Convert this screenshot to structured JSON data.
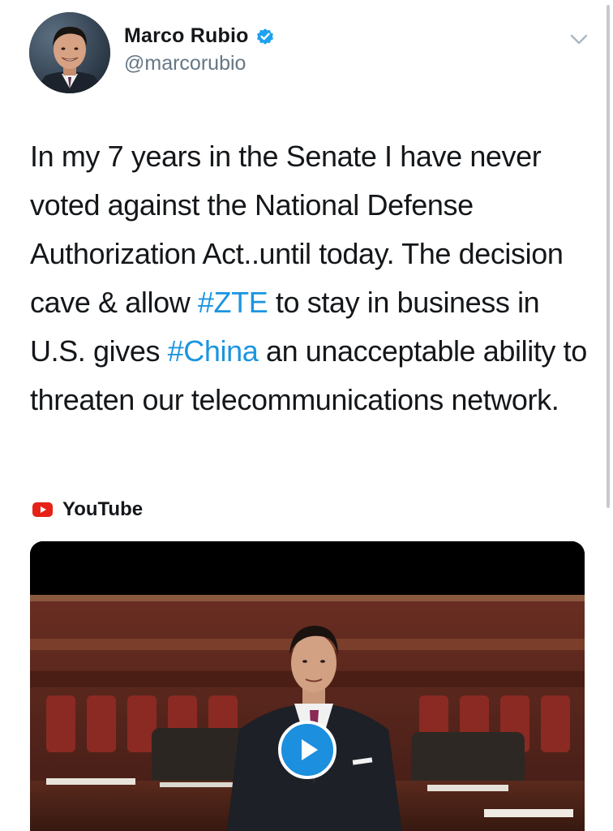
{
  "profile": {
    "display_name": "Marco Rubio",
    "handle": "@marcorubio",
    "verified": true,
    "avatar_icon": "profile-photo"
  },
  "menu": {
    "icon": "chevron-down-icon"
  },
  "tweet": {
    "segments": [
      {
        "text": "In my 7 years in the Senate I have never voted against the National Defense Authorization Act..until today. The decision cave & allow ",
        "type": "text"
      },
      {
        "text": "#ZTE",
        "type": "hashtag"
      },
      {
        "text": " to stay in business in U.S. gives ",
        "type": "text"
      },
      {
        "text": "#China",
        "type": "hashtag"
      },
      {
        "text": " an unacceptable ability to threaten our telecommunications network.",
        "type": "text"
      }
    ]
  },
  "card": {
    "source_label": "YouTube",
    "source_icon": "youtube-icon",
    "play_icon": "play-icon"
  },
  "colors": {
    "text_primary": "#14171a",
    "text_secondary": "#657786",
    "link": "#1b95e0",
    "verified": "#1da1f2",
    "youtube_red": "#e62117",
    "play_button": "#1c8fde"
  }
}
